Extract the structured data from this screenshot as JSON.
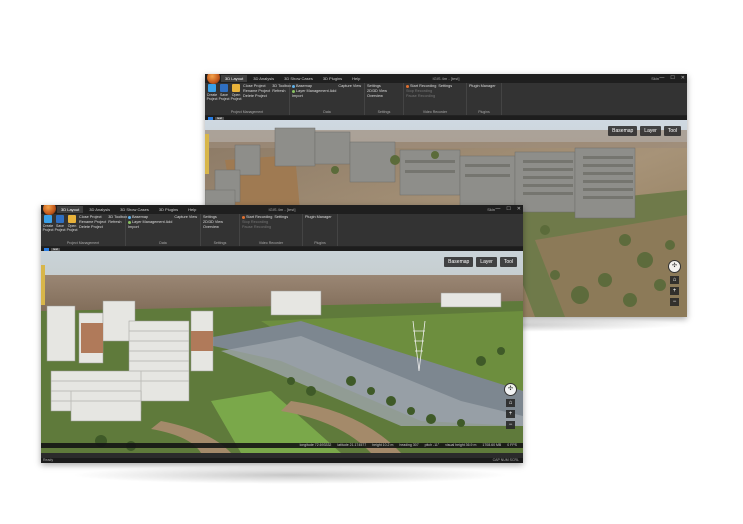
{
  "window_title": "IGIS 4m - [test]",
  "menu_tabs": [
    "3D Layout",
    "3D Analysis",
    "3D Show Cases",
    "3D Plugins",
    "Help"
  ],
  "skin_label": "Skin",
  "win_controls": [
    "—",
    "☐",
    "✕"
  ],
  "ribbon": {
    "project": {
      "create": "Create Project",
      "save": "Save Project",
      "open": "Open Project",
      "close": "Close Project",
      "rename": "Rename Project",
      "delete": "Delete Project",
      "toolbox": "3D Toolbox",
      "refresh": "Refresh",
      "group": "Project Management"
    },
    "data": {
      "basemap": "Basemap",
      "layer_mgmt": "Layer Management",
      "add": "Add",
      "import": "Import",
      "capture": "Capture View",
      "group": "Data"
    },
    "settings": {
      "settings": "Settings",
      "view_2d3d": "2D/3D View",
      "overview": "Overview",
      "group": "Settings"
    },
    "video": {
      "start": "Start Recording",
      "stop": "Stop Recording",
      "pause": "Pause Recording",
      "settings": "Settings",
      "group": "Video Recorder"
    },
    "plugins": {
      "manager": "Plugin Manager",
      "group": "Plugins"
    }
  },
  "sub_tab": "test",
  "overlay": {
    "basemap": "Basemap",
    "layer": "Layer",
    "tool": "Tool"
  },
  "status": {
    "longitude": "longitude 72.693332",
    "latitude": "latitude 21.174577",
    "height": "height 10.2 m",
    "heading": "heading 307",
    "pitch": "pitch -11°",
    "visual_height": "visual height 36.9 m",
    "memory": "1708.60 MB",
    "fps": "0 FPS"
  },
  "ready": "Ready",
  "caps": "CAP NUM SCRL",
  "colors": {
    "accent": "#2a7de1",
    "ribbon_bg": "#333333",
    "titlebar_bg": "#1f1f1f"
  }
}
